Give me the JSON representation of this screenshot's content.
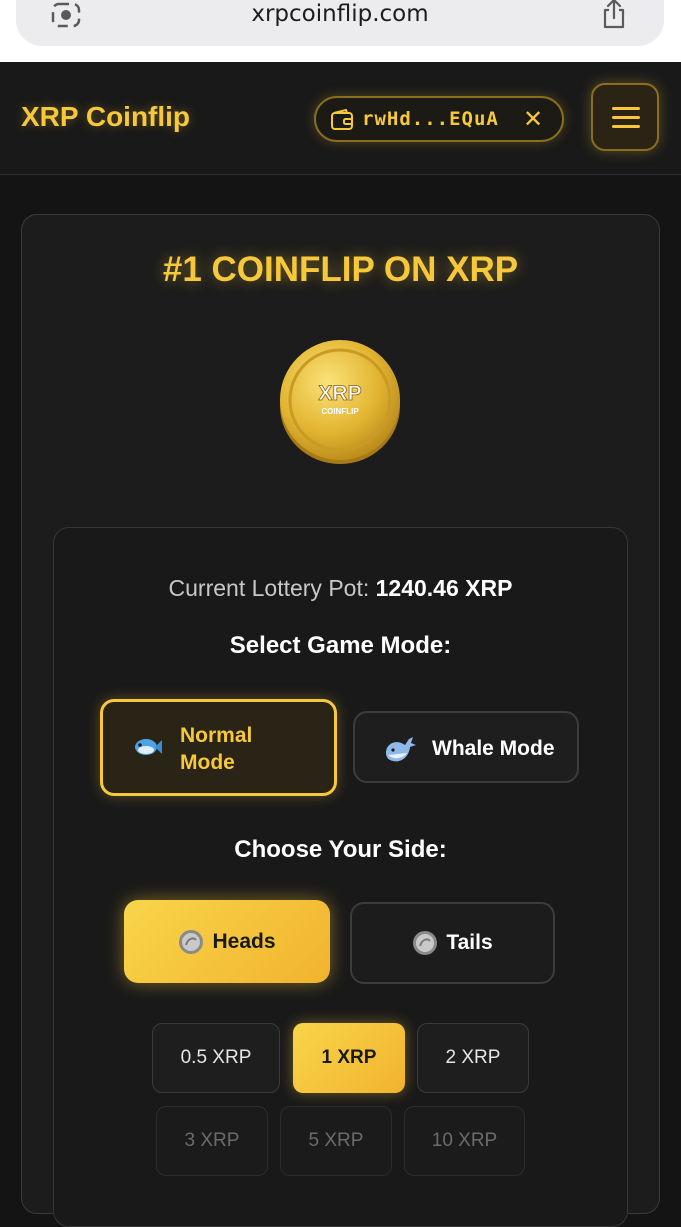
{
  "browser": {
    "url": "xrpcoinflip.com"
  },
  "header": {
    "brand": "XRP Coinflip",
    "wallet_address": "rwHd...EQuA",
    "disconnect_glyph": "✕"
  },
  "hero": {
    "title": "#1 COINFLIP ON XRP",
    "coin_text_top": "XRP",
    "coin_text_bottom": "COINFLIP"
  },
  "lottery": {
    "label": "Current Lottery Pot:",
    "value": "1240.46 XRP"
  },
  "game_mode": {
    "title": "Select Game Mode:",
    "options": [
      {
        "label_line1": "Normal",
        "label_line2": "Mode",
        "icon": "fish-icon",
        "selected": true
      },
      {
        "label": "Whale Mode",
        "icon": "whale-icon",
        "selected": false
      }
    ]
  },
  "side": {
    "title": "Choose Your Side:",
    "options": [
      {
        "label": "Heads",
        "icon": "coin-icon",
        "selected": true
      },
      {
        "label": "Tails",
        "icon": "coin-icon",
        "selected": false
      }
    ]
  },
  "bets": [
    {
      "label": "0.5 XRP",
      "state": "normal"
    },
    {
      "label": "1 XRP",
      "state": "selected"
    },
    {
      "label": "2 XRP",
      "state": "normal"
    },
    {
      "label": "3 XRP",
      "state": "disabled"
    },
    {
      "label": "5 XRP",
      "state": "disabled"
    },
    {
      "label": "10 XRP",
      "state": "disabled"
    }
  ],
  "colors": {
    "accent": "#f6c83a",
    "background": "#141414",
    "card": "#1c1c1c"
  }
}
